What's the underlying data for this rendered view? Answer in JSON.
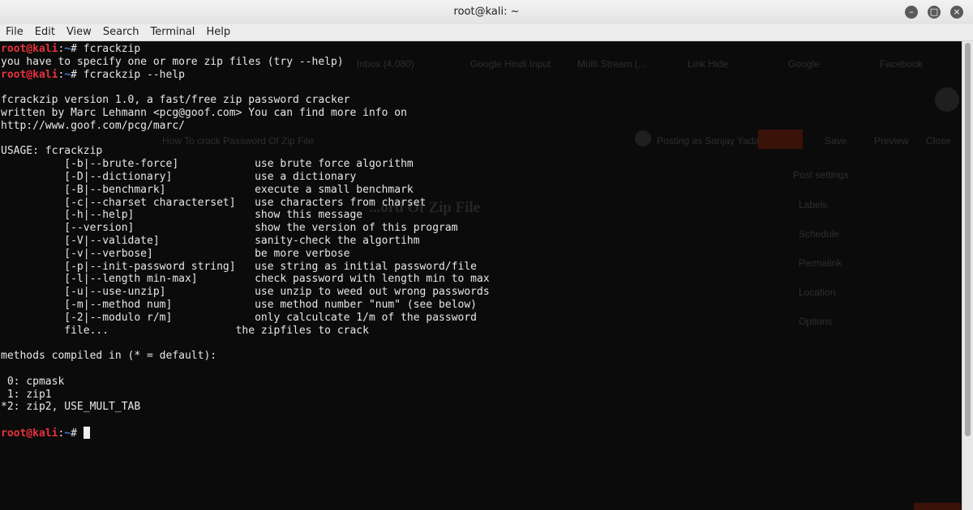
{
  "window": {
    "title": "root@kali: ~",
    "buttons": {
      "minimize": "–",
      "maximize": "□",
      "close": "×"
    }
  },
  "menu": [
    "File",
    "Edit",
    "View",
    "Search",
    "Terminal",
    "Help"
  ],
  "prompt": {
    "user": "root@kali",
    "sep": ":",
    "path": "~",
    "symbol": "# "
  },
  "terminal": {
    "cmd1": "fcrackzip",
    "err1": "you have to specify one or more zip files (try --help)",
    "cmd2": "fcrackzip --help",
    "banner": [
      "fcrackzip version 1.0, a fast/free zip password cracker",
      "written by Marc Lehmann <pcg@goof.com> You can find more info on",
      "http://www.goof.com/pcg/marc/"
    ],
    "usage": "USAGE: fcrackzip",
    "options": [
      "          [-b|--brute-force]            use brute force algorithm",
      "          [-D|--dictionary]             use a dictionary",
      "          [-B|--benchmark]              execute a small benchmark",
      "          [-c|--charset characterset]   use characters from charset",
      "          [-h|--help]                   show this message",
      "          [--version]                   show the version of this program",
      "          [-V|--validate]               sanity-check the algortihm",
      "          [-v|--verbose]                be more verbose",
      "          [-p|--init-password string]   use string as initial password/file",
      "          [-l|--length min-max]         check password with length min to max",
      "          [-u|--use-unzip]              use unzip to weed out wrong passwords",
      "          [-m|--method num]             use method number \"num\" (see below)",
      "          [-2|--modulo r/m]             only calculcate 1/m of the password",
      "          file...                    the zipfiles to crack"
    ],
    "methods_header": "methods compiled in (* = default):",
    "methods": [
      " 0: cpmask",
      " 1: zip1",
      "*2: zip2, USE_MULT_TAB"
    ]
  },
  "background_ghost": {
    "tabs": [
      "Inbox (4,080)",
      "Google Hindi Input",
      "Multi Stream (...",
      "Link Hide",
      "Google",
      "Facebook"
    ],
    "post_title": "How To crack Password Of Zip File",
    "heading": "...ord Of Zip File",
    "author": "Posting as Sanjay Yadav",
    "buttons": [
      "Publish",
      "Save",
      "Preview",
      "Close"
    ],
    "sidebar": [
      "Post settings",
      "Labels",
      "Schedule",
      "Permalink",
      "Location",
      "Options"
    ]
  }
}
